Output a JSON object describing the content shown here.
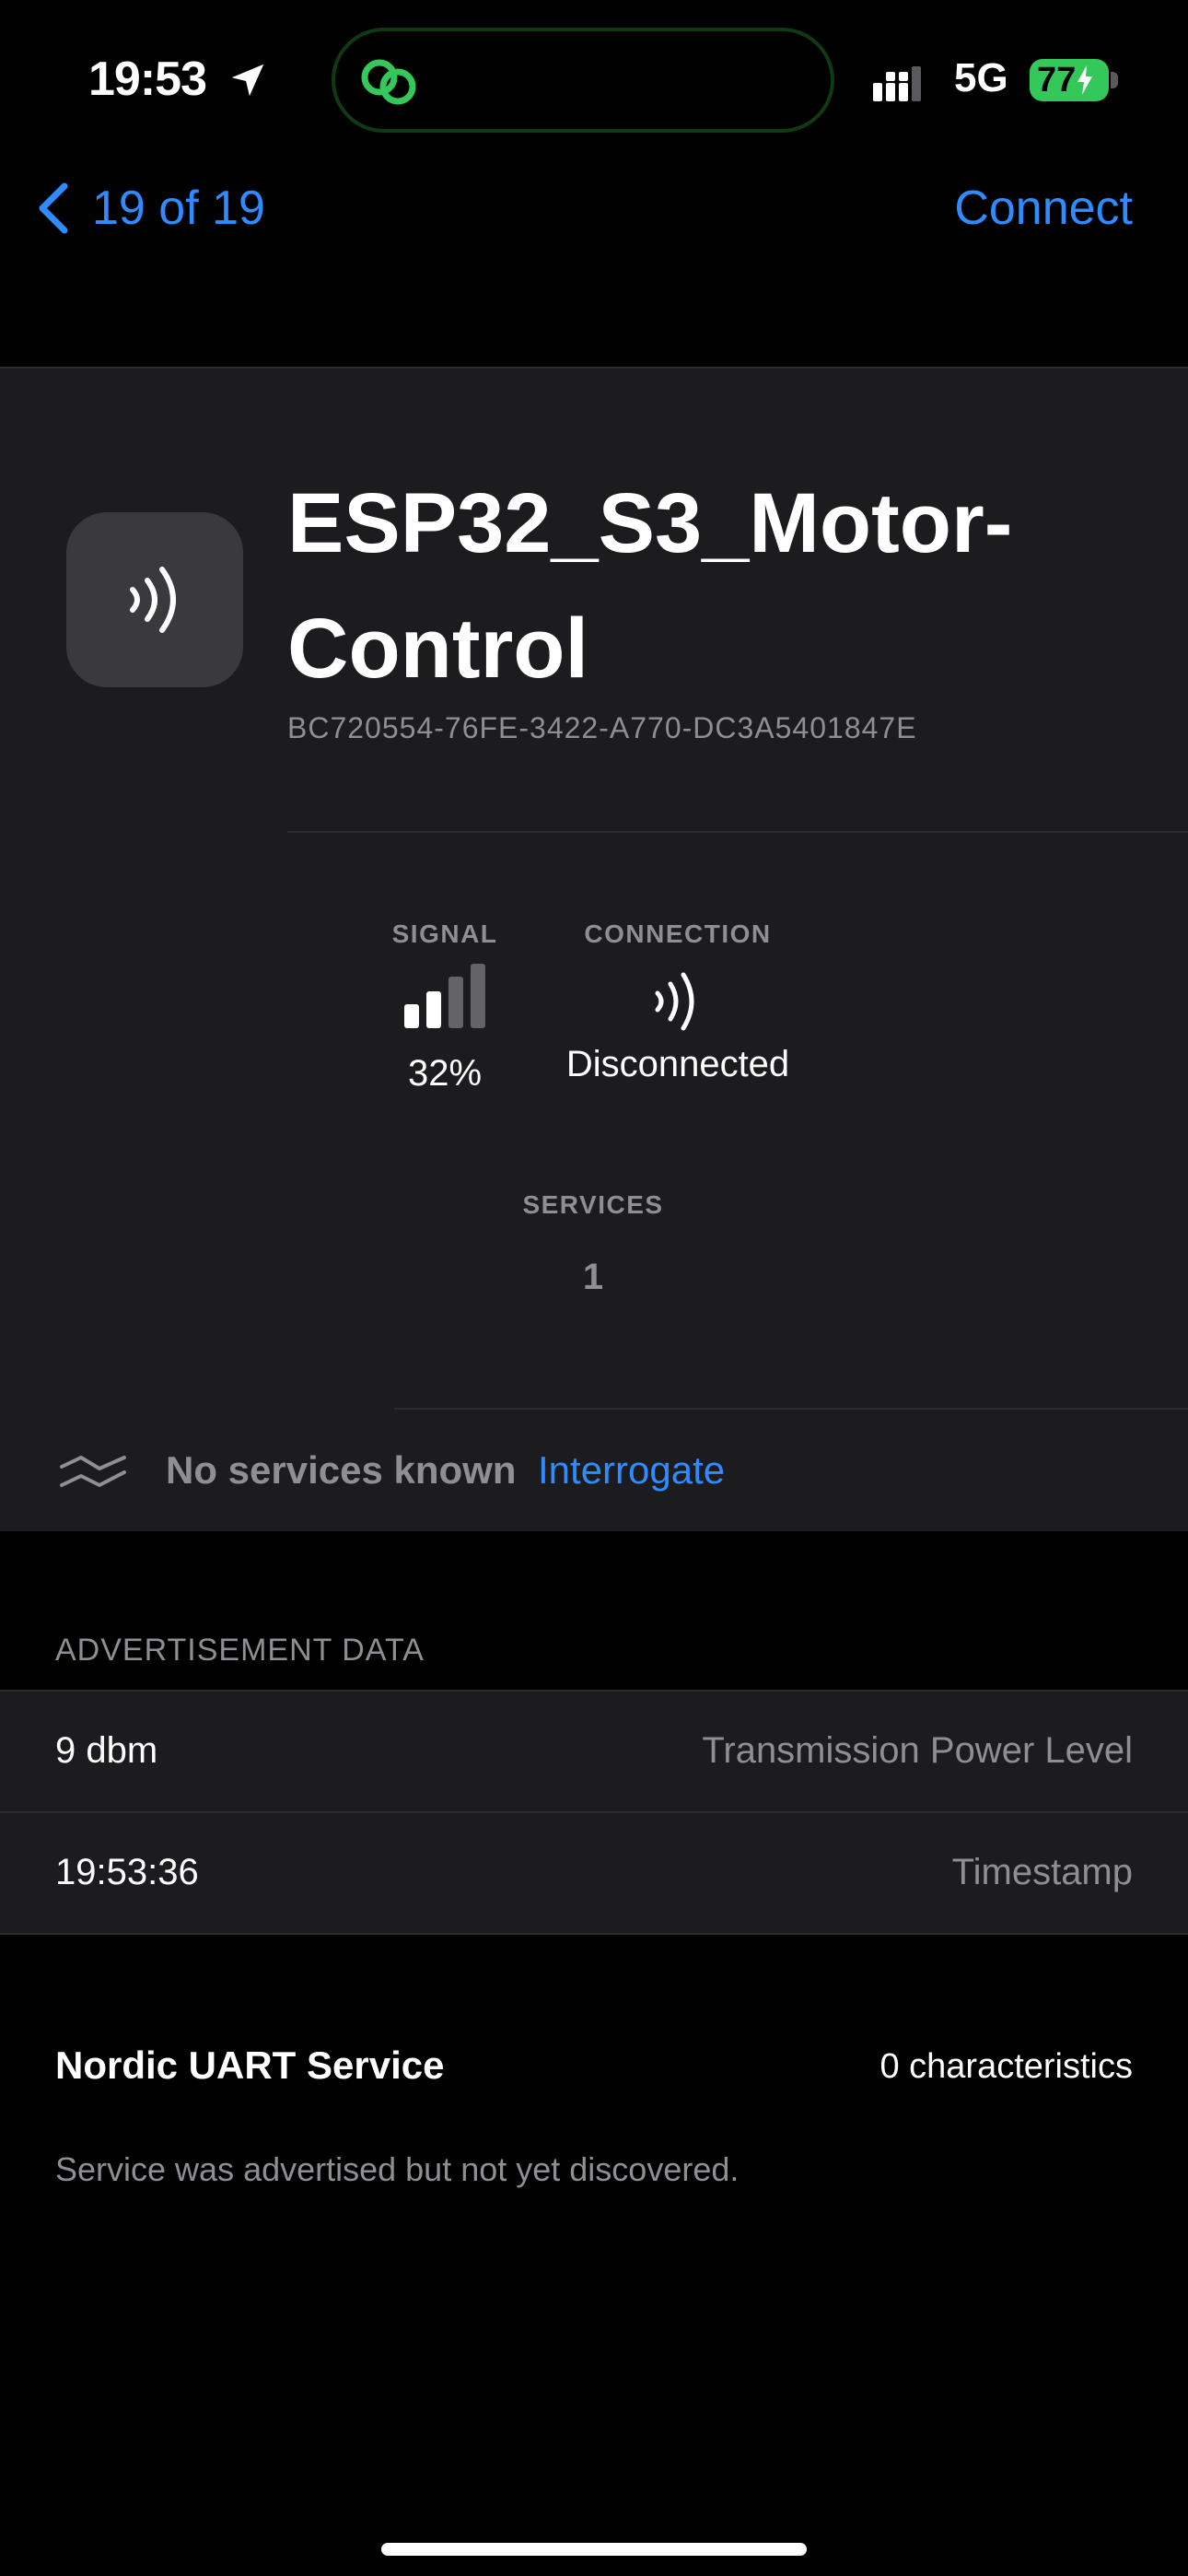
{
  "status_bar": {
    "time": "19:53",
    "network": "5G",
    "battery": "77"
  },
  "nav": {
    "back_label": "19 of 19",
    "connect_label": "Connect"
  },
  "device": {
    "name": "ESP32_S3_Motor-Control",
    "uuid": "BC720554-76FE-3422-A770-DC3A5401847E"
  },
  "stats": {
    "signal_label": "SIGNAL",
    "signal_value": "32%",
    "signal_level": 0.5,
    "connection_label": "CONNECTION",
    "connection_value": "Disconnected",
    "services_label": "SERVICES",
    "services_value": "1"
  },
  "services_banner": {
    "text": "No services known",
    "action": "Interrogate"
  },
  "advertisement": {
    "header": "ADVERTISEMENT DATA",
    "rows": [
      {
        "value": "9 dbm",
        "key": "Transmission Power Level"
      },
      {
        "value": "19:53:36",
        "key": "Timestamp"
      }
    ]
  },
  "service": {
    "name": "Nordic UART Service",
    "characteristics": "0 characteristics",
    "note": "Service was advertised but not yet discovered."
  },
  "colors": {
    "accent": "#2f8bff",
    "battery": "#34c759",
    "island_icon": "#34c759"
  }
}
